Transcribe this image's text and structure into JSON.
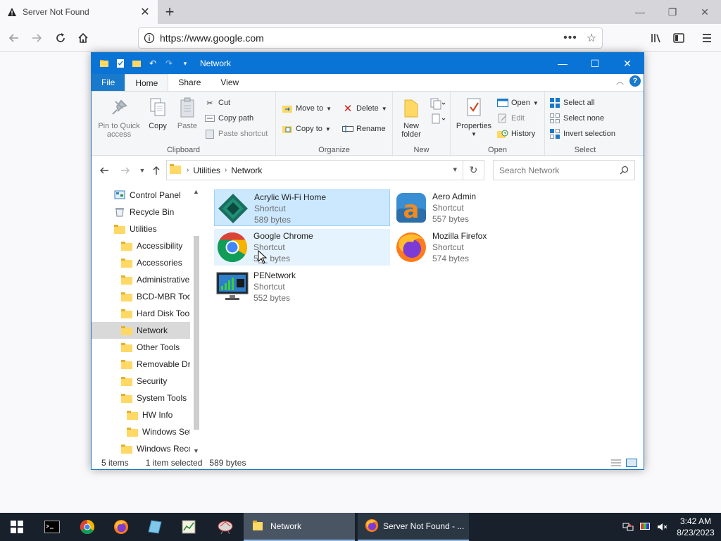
{
  "browser": {
    "tab_title": "Server Not Found",
    "url": "https://www.google.com"
  },
  "explorer": {
    "window_title": "Network",
    "ribbon_tabs": [
      "File",
      "Home",
      "Share",
      "View"
    ],
    "clipboard": {
      "pin": "Pin to Quick access",
      "copy": "Copy",
      "paste": "Paste",
      "cut": "Cut",
      "copy_path": "Copy path",
      "paste_shortcut": "Paste shortcut",
      "label": "Clipboard"
    },
    "organize": {
      "move_to": "Move to",
      "copy_to": "Copy to",
      "delete": "Delete",
      "rename": "Rename",
      "label": "Organize"
    },
    "new": {
      "new_folder": "New folder",
      "label": "New"
    },
    "open": {
      "properties": "Properties",
      "open": "Open",
      "edit": "Edit",
      "history": "History",
      "label": "Open"
    },
    "select": {
      "select_all": "Select all",
      "select_none": "Select none",
      "invert": "Invert selection",
      "label": "Select"
    },
    "address": {
      "crumbs": [
        "Utilities",
        "Network"
      ],
      "search_placeholder": "Search Network"
    },
    "nav_items": [
      {
        "label": "Control Panel",
        "indent": 0,
        "icon": "control-panel-icon"
      },
      {
        "label": "Recycle Bin",
        "indent": 0,
        "icon": "recycle-bin-icon"
      },
      {
        "label": "Utilities",
        "indent": 0,
        "icon": "folder-icon"
      },
      {
        "label": "Accessibility",
        "indent": 1,
        "icon": "folder-icon"
      },
      {
        "label": "Accessories",
        "indent": 1,
        "icon": "folder-icon"
      },
      {
        "label": "Administrative",
        "indent": 1,
        "icon": "folder-icon"
      },
      {
        "label": "BCD-MBR Tool",
        "indent": 1,
        "icon": "folder-icon"
      },
      {
        "label": "Hard Disk Tools",
        "indent": 1,
        "icon": "folder-icon"
      },
      {
        "label": "Network",
        "indent": 1,
        "icon": "folder-icon"
      },
      {
        "label": "Other Tools",
        "indent": 1,
        "icon": "folder-icon"
      },
      {
        "label": "Removable Dri",
        "indent": 1,
        "icon": "folder-icon"
      },
      {
        "label": "Security",
        "indent": 1,
        "icon": "folder-icon"
      },
      {
        "label": "System Tools",
        "indent": 1,
        "icon": "folder-icon"
      },
      {
        "label": "HW Info",
        "indent": 2,
        "icon": "folder-icon"
      },
      {
        "label": "Windows Setu",
        "indent": 2,
        "icon": "folder-icon"
      },
      {
        "label": "Windows Reco",
        "indent": 1,
        "icon": "folder-icon"
      }
    ],
    "files": [
      {
        "name": "Acrylic Wi-Fi Home",
        "type": "Shortcut",
        "size": "589 bytes",
        "icon": "acrylic-wifi-icon"
      },
      {
        "name": "Aero Admin",
        "type": "Shortcut",
        "size": "557 bytes",
        "icon": "aero-admin-icon"
      },
      {
        "name": "Google Chrome",
        "type": "Shortcut",
        "size": "5__ bytes",
        "icon": "chrome-icon"
      },
      {
        "name": "Mozilla Firefox",
        "type": "Shortcut",
        "size": "574 bytes",
        "icon": "firefox-icon"
      },
      {
        "name": "PENetwork",
        "type": "Shortcut",
        "size": "552 bytes",
        "icon": "penetwork-icon"
      }
    ],
    "status": {
      "items": "5 items",
      "selected": "1 item selected",
      "size": "589 bytes"
    }
  },
  "taskbar": {
    "explorer_label": "Network",
    "firefox_label": "Server Not Found - ...",
    "time": "3:42 AM",
    "date": "8/23/2023"
  },
  "colors": {
    "accent": "#0a74d6",
    "selection": "#cce8ff",
    "taskbar": "#18212b"
  }
}
